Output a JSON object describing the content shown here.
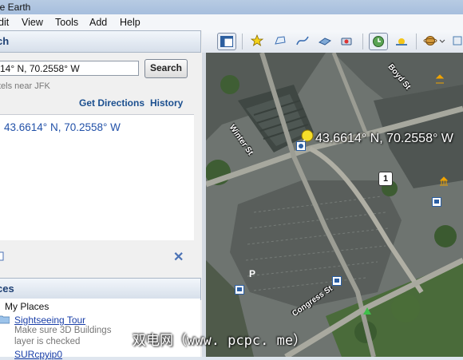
{
  "window": {
    "title": "le Earth"
  },
  "menu": [
    "dit",
    "View",
    "Tools",
    "Add",
    "Help"
  ],
  "search_panel": {
    "header": "ch",
    "input_value": "14° N, 70.2558° W",
    "search_button": "Search",
    "hint": "tels near JFK",
    "get_directions": "Get Directions",
    "history": "History",
    "result": "43.6614° N, 70.2558° W"
  },
  "places_panel": {
    "header": "ces",
    "items": [
      {
        "label": "My Places"
      },
      {
        "label": "Sightseeing Tour",
        "desc_line1": "Make sure 3D Buildings",
        "desc_line2": "layer is checked"
      },
      {
        "label": "SURcpyip0"
      }
    ]
  },
  "map": {
    "placemark_label": "43.6614° N, 70.2558° W",
    "streets": [
      "Winter St",
      "Congress St",
      "Boyd St"
    ],
    "route_shield": "1",
    "parking_glyph": "P"
  },
  "watermark": "双电网（www. pcpc. me）",
  "colors": {
    "link": "#1b4f8f",
    "result": "#2251a8",
    "header_text": "#1d3f73"
  }
}
